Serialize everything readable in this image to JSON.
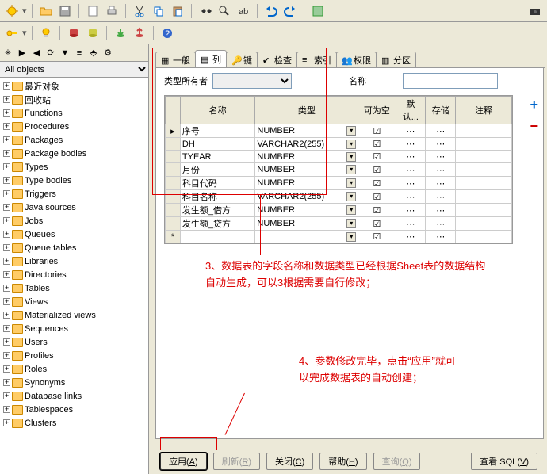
{
  "toolbar1_icons": [
    "sunburst",
    "open",
    "save",
    "blank",
    "print",
    "blank",
    "scissors",
    "copy",
    "paste",
    "blank",
    "find",
    "find2",
    "blank",
    "undo",
    "redo",
    "blank",
    "run",
    "spy"
  ],
  "toolbar2_icons": [
    "key",
    "bulb",
    "down",
    "blank",
    "cyl-r",
    "cyl-y",
    "blank",
    "help-blue",
    "cyl-b",
    "blank",
    "help"
  ],
  "side_icons": [
    "sun",
    "right",
    "left",
    "refresh",
    "filter",
    "tree",
    "pin",
    "gear"
  ],
  "obj_filter": "All objects",
  "tree": [
    "最近对象",
    "回收站",
    "Functions",
    "Procedures",
    "Packages",
    "Package bodies",
    "Types",
    "Type bodies",
    "Triggers",
    "Java sources",
    "Jobs",
    "Queues",
    "Queue tables",
    "Libraries",
    "Directories",
    "Tables",
    "Views",
    "Materialized views",
    "Sequences",
    "Users",
    "Profiles",
    "Roles",
    "Synonyms",
    "Database links",
    "Tablespaces",
    "Clusters"
  ],
  "tabs": [
    {
      "label": "一般"
    },
    {
      "label": "列",
      "active": true
    },
    {
      "label": "键"
    },
    {
      "label": "检查"
    },
    {
      "label": "索引"
    },
    {
      "label": "权限"
    },
    {
      "label": "分区"
    }
  ],
  "owner_label": "类型所有者",
  "name_label": "名称",
  "grid": {
    "headers": [
      "名称",
      "类型",
      "可为空",
      "默认...",
      "存储",
      "注释"
    ],
    "rows": [
      {
        "name": "序号",
        "type": "NUMBER",
        "null": true
      },
      {
        "name": "DH",
        "type": "VARCHAR2(255)",
        "null": true
      },
      {
        "name": "TYEAR",
        "type": "NUMBER",
        "null": true
      },
      {
        "name": "月份",
        "type": "NUMBER",
        "null": true
      },
      {
        "name": "科目代码",
        "type": "NUMBER",
        "null": true
      },
      {
        "name": "科目名称",
        "type": "VARCHAR2(255)",
        "null": true
      },
      {
        "name": "发生额_借方",
        "type": "NUMBER",
        "null": true
      },
      {
        "name": "发生额_贷方",
        "type": "NUMBER",
        "null": true
      }
    ]
  },
  "annot1": "3、数据表的字段名称和数据类型已经根据Sheet表的数据结构自动生成，可以3根据需要自行修改；",
  "annot2": "4、参数修改完毕，点击“应用”就可以完成数据表的自动创建；",
  "buttons": {
    "apply": "应用",
    "apply_k": "A",
    "refresh": "刷新",
    "refresh_k": "R",
    "close": "关闭",
    "close_k": "C",
    "help": "帮助",
    "help_k": "H",
    "query": "查询",
    "query_k": "Q",
    "sql": "查看 SQL",
    "sql_k": "V"
  }
}
